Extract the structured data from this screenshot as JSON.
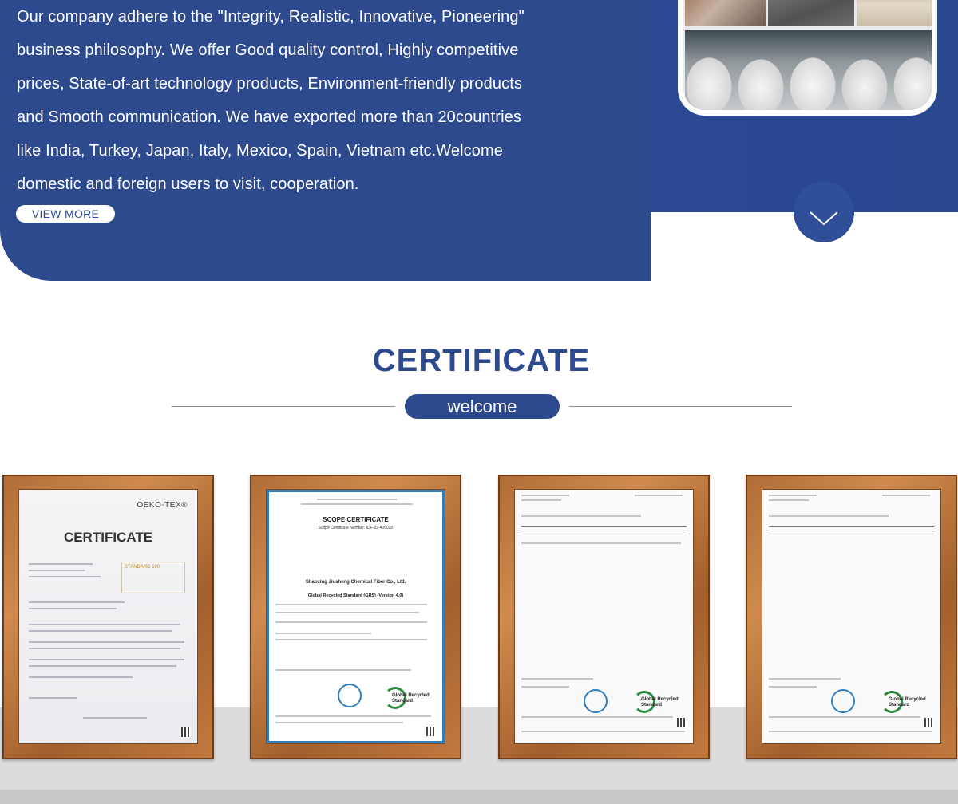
{
  "about": {
    "lines": [
      "Our company adhere to the \"Integrity, Realistic, Innovative, Pioneering\"",
      "business philosophy. We offer Good quality control, Highly competitive",
      "prices, State-of-art technology products, Environment-friendly products",
      "and Smooth communication. We have exported more than 20countries",
      "like India, Turkey, Japan, Italy, Mexico, Spain, Vietnam etc.Welcome",
      "domestic and foreign users to visit, cooperation."
    ],
    "view_more_label": "VIEW MORE"
  },
  "scroll_icon": "chevron-down-icon",
  "colors": {
    "brand": "#2d4a8f",
    "band": "#243f86",
    "frame_wood": "#b06c36"
  },
  "certificate": {
    "title": "CERTIFICATE",
    "subtitle": "welcome",
    "items": [
      {
        "brand": "OEKO-TEX®",
        "heading": "CERTIFICATE",
        "badge": "STANDARD 100"
      },
      {
        "heading": "SCOPE CERTIFICATE",
        "number": "Scope Certificate Number: IDF-22-405030",
        "company": "Shaoxing Jiusheng Chemical Fiber Co., Ltd.",
        "standard": "Global Recycled Standard (GRS) (Version 4.0)",
        "logo": "Global Recycled Standard"
      },
      {
        "logo": "Global Recycled Standard"
      },
      {
        "logo": "Global Recycled Standard"
      }
    ]
  }
}
